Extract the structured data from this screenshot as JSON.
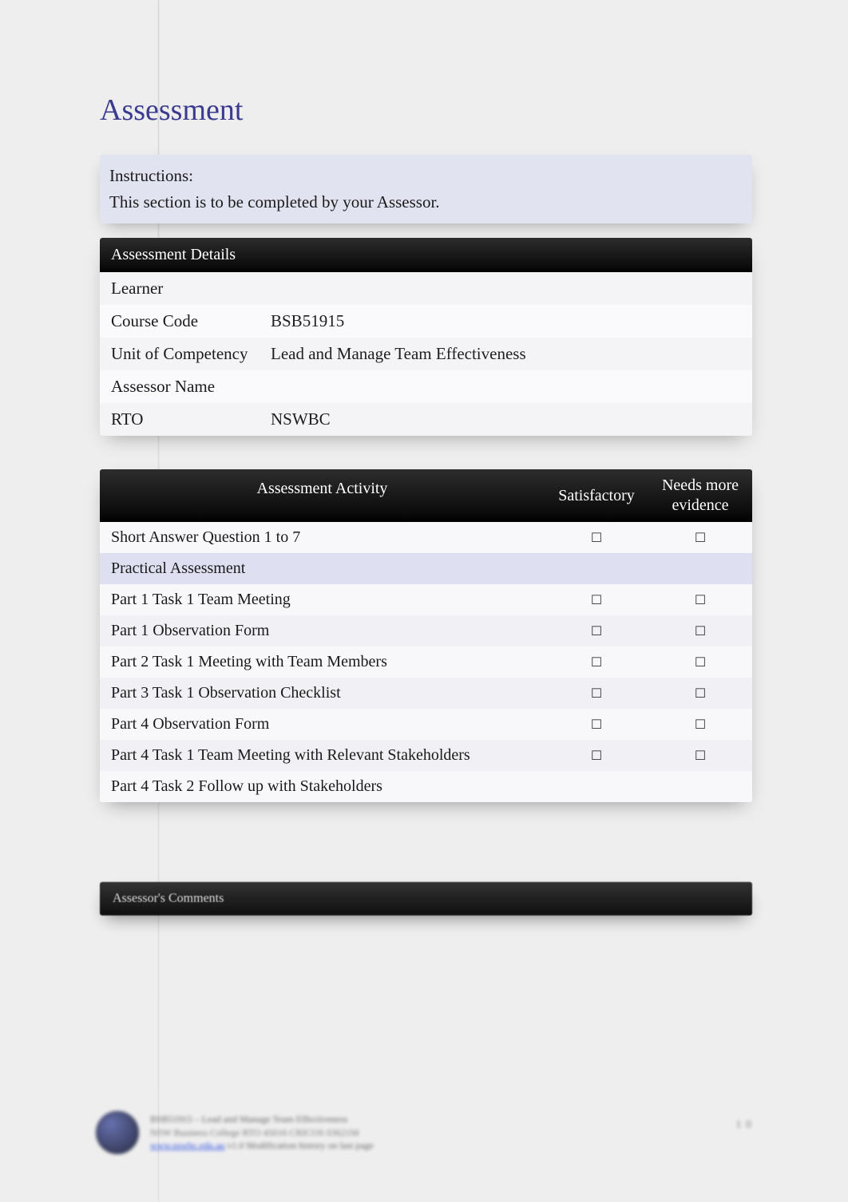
{
  "heading": "Assessment",
  "instructions": {
    "label": "Instructions:",
    "text": "This section is to be completed by your Assessor."
  },
  "details_header": "Assessment Details",
  "details": {
    "learner_label": "Learner",
    "learner_value": "",
    "course_code_label": "Course Code",
    "course_code_value": "BSB51915",
    "unit_label": "Unit of Competency",
    "unit_value": "Lead and Manage Team Effectiveness",
    "assessor_label": "Assessor Name",
    "assessor_value": "",
    "rto_label": "RTO",
    "rto_value": "NSWBC"
  },
  "activity_header": {
    "col1": "Assessment Activity",
    "col2": "Satisfactory",
    "col3": "Needs more evidence"
  },
  "checkbox_glyph": "☐",
  "activities": [
    {
      "label": "Short Answer Question 1 to 7",
      "type": "item"
    },
    {
      "label": "Practical Assessment",
      "type": "subhead"
    },
    {
      "label": "Part 1 Task 1 Team Meeting",
      "type": "item"
    },
    {
      "label": "Part 1 Observation Form",
      "type": "item"
    },
    {
      "label": "Part 2 Task 1 Meeting with Team Members",
      "type": "item"
    },
    {
      "label": "Part 3 Task 1 Observation Checklist",
      "type": "item"
    },
    {
      "label": "Part 4 Observation Form",
      "type": "item"
    },
    {
      "label": "Part 4 Task 1 Team Meeting with Relevant Stakeholders",
      "type": "item"
    },
    {
      "label": "Part 4 Task 2 Follow up with Stakeholders",
      "type": "item_nobox"
    }
  ],
  "comments_header": "Assessor's Comments",
  "footer": {
    "line1": "BSB51915 – Lead and Manage Team Effectiveness",
    "line2": "NSW Business College  RTO 45016  CRICOS 03621M",
    "link": "www.nswbc.edu.au",
    "rest": "  v1.0   Modification history on last page",
    "page": "1 0"
  }
}
